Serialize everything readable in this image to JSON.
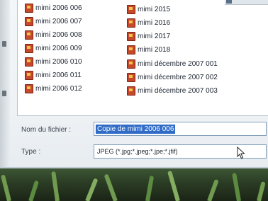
{
  "file_list": {
    "column1": [
      "mimi 2006 006",
      "mimi 2006 007",
      "mimi 2006 008",
      "mimi 2006 009",
      "mimi 2006 010",
      "mimi 2006 011",
      "mimi 2006 012"
    ],
    "column2": [
      "mimi 2015",
      "mimi 2016",
      "mimi 2017",
      "mimi 2018",
      "mimi décembre 2007 001",
      "mimi décembre 2007 002",
      "mimi décembre 2007 003"
    ],
    "icon": "jpeg-image-file-icon"
  },
  "form": {
    "filename_label": "Nom du fichier :",
    "filename_value": "Copie de mimi 2006 006",
    "type_label": "Type :",
    "type_value": "JPEG (*.jpg;*.jpeg;*.jpe;*.jfif)"
  },
  "colors": {
    "selection": "#2f6bc7",
    "icon": "#c6482b",
    "panel": "#ffffff"
  }
}
